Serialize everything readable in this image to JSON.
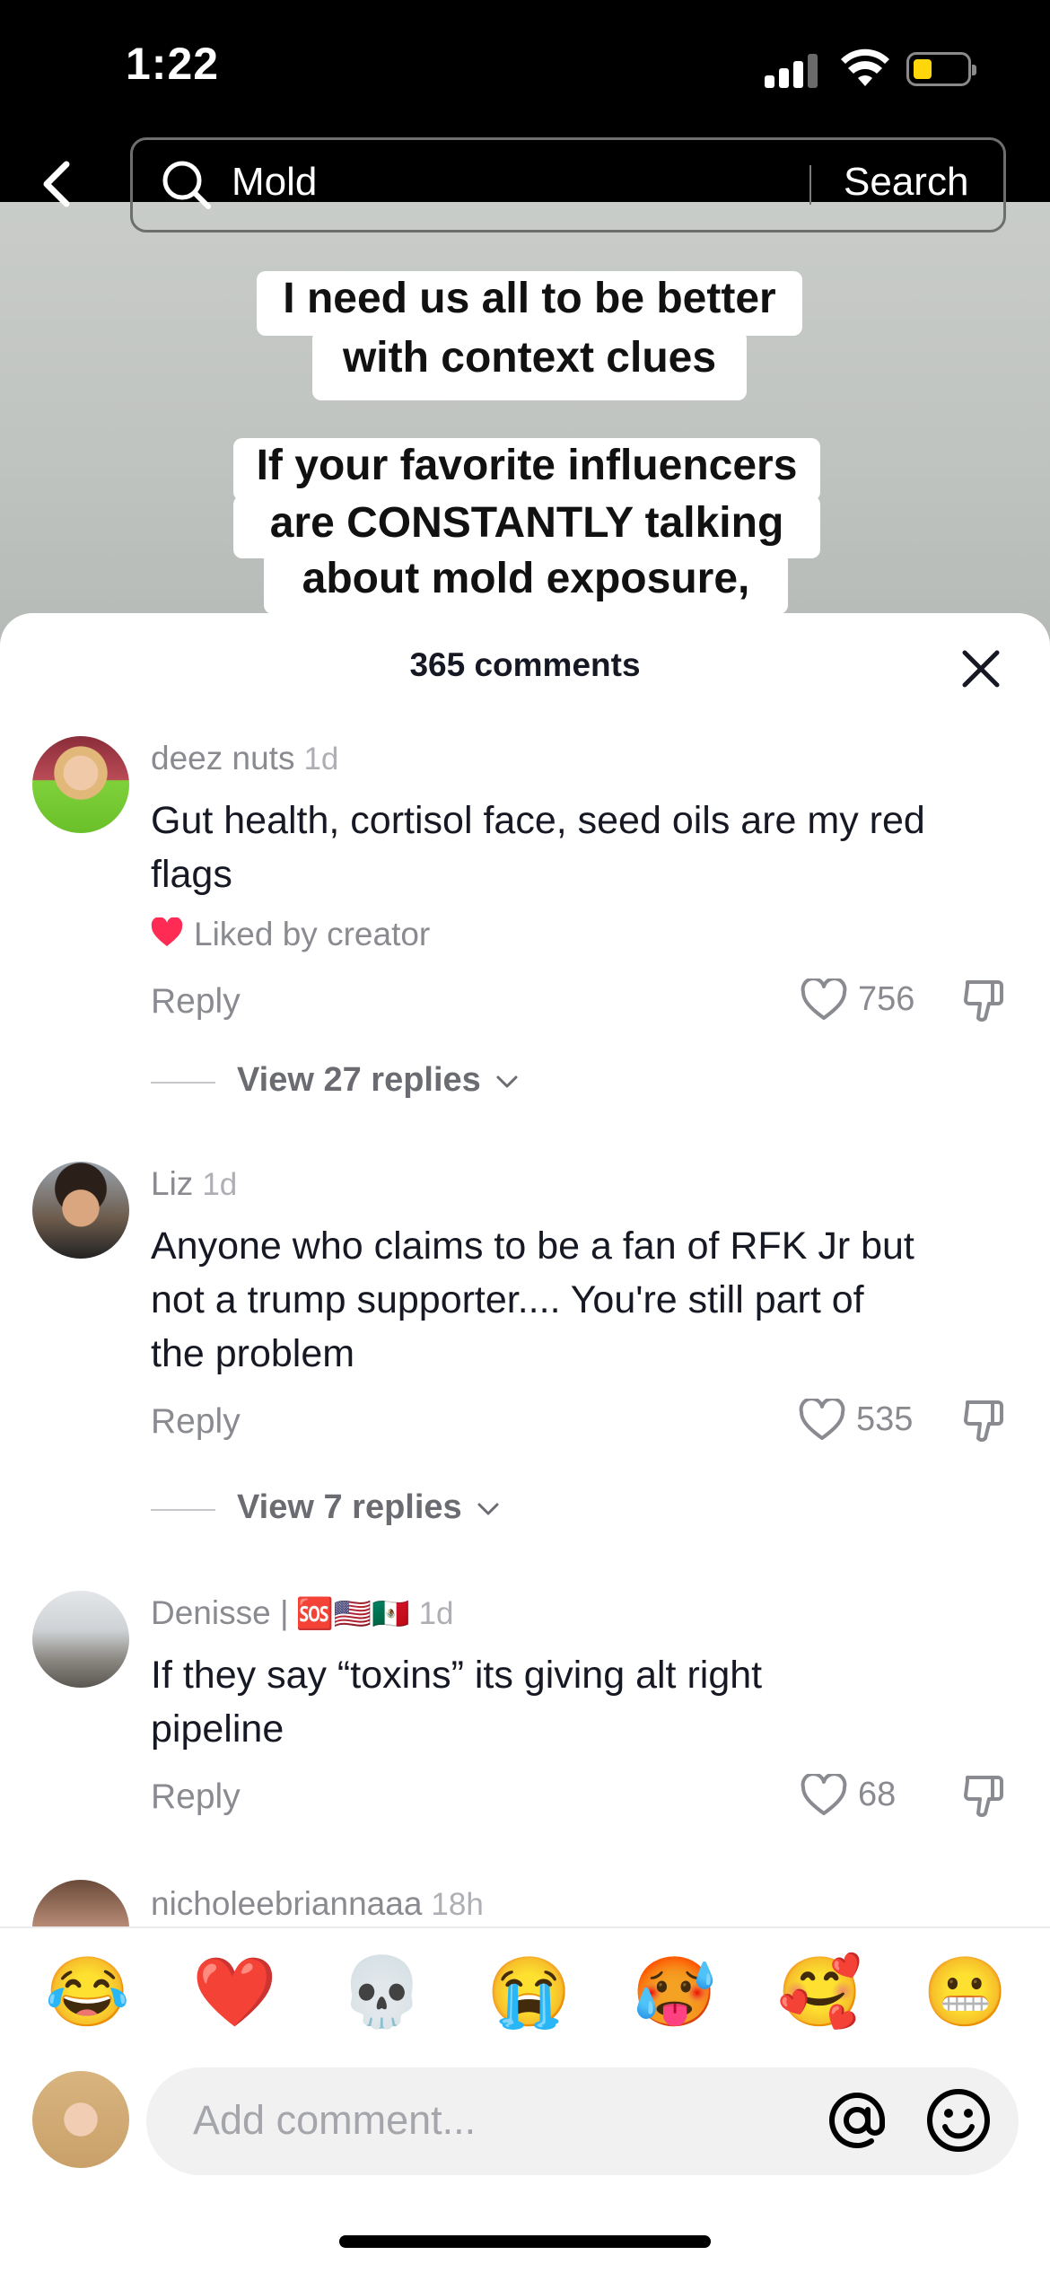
{
  "status_bar": {
    "time": "1:22"
  },
  "search": {
    "query": "Mold",
    "button_label": "Search"
  },
  "video": {
    "caption_line1": "I need us all to be better",
    "caption_line2": "with context clues",
    "caption_line3": "If your favorite influencers",
    "caption_line4": "are CONSTANTLY talking",
    "caption_line5": "about mold exposure,"
  },
  "comments_panel": {
    "count_label": "365 comments",
    "comments": [
      {
        "username": "deez nuts",
        "time": "1d",
        "text_line1": "Gut health, cortisol face, seed oils are my red",
        "text_line2": "flags",
        "liked_by_creator": "Liked by creator",
        "reply_label": "Reply",
        "likes": "756",
        "view_replies": "View 27 replies"
      },
      {
        "username": "Liz",
        "time": "1d",
        "text_line1": "Anyone who claims to be a fan of RFK Jr but",
        "text_line2": "not a trump supporter.... You're still part of",
        "text_line3": "the problem",
        "reply_label": "Reply",
        "likes": "535",
        "view_replies": "View 7 replies"
      },
      {
        "username": "Denisse |",
        "username_emojis": "🆘🇺🇸🇲🇽",
        "time": "1d",
        "text_line1": "If they say “toxins” its giving alt right",
        "text_line2": "pipeline",
        "reply_label": "Reply",
        "likes": "68"
      },
      {
        "username": "nicholeebriannaaa",
        "time": "18h"
      }
    ]
  },
  "emoji_bar": [
    "😂",
    "❤️",
    "💀",
    "😭",
    "🥵",
    "🥰",
    "😬"
  ],
  "composer": {
    "placeholder": "Add comment..."
  },
  "colors": {
    "liked_heart": "#fe2c55",
    "battery": "#ffd60a"
  },
  "icons": [
    "back-arrow-icon",
    "search-icon",
    "close-icon",
    "heart-icon",
    "dislike-icon",
    "chevron-down-icon",
    "at-icon",
    "smile-icon"
  ]
}
